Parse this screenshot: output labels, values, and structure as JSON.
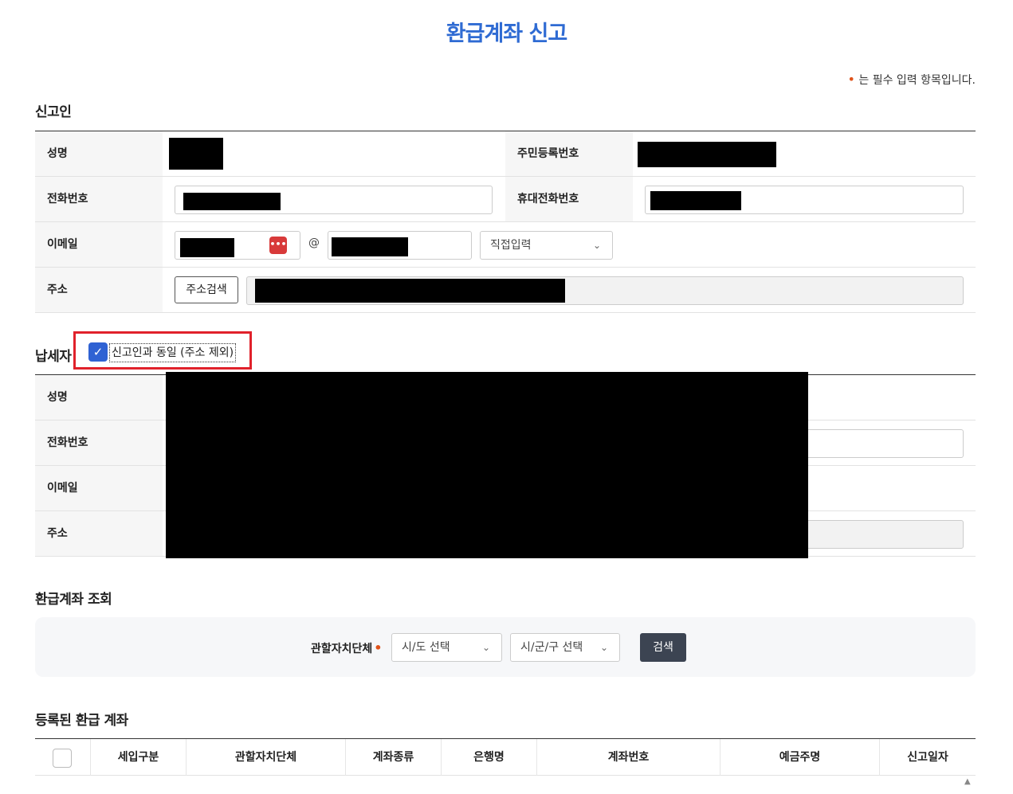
{
  "page": {
    "title": "환급계좌 신고",
    "required_note": "는 필수 입력 항목입니다.",
    "required_mark": "•"
  },
  "reporter": {
    "section_title": "신고인",
    "name_label": "성명",
    "rrn_label": "주민등록번호",
    "phone_label": "전화번호",
    "mobile_label": "휴대전화번호",
    "email_label": "이메일",
    "email_at": "@",
    "email_domain_select": "직접입력",
    "address_label": "주소",
    "address_search_button": "주소검색"
  },
  "taxpayer": {
    "section_title": "납세자",
    "same_as_reporter_label": "신고인과 동일 (주소 제외)",
    "same_as_reporter_checked": true,
    "name_label": "성명",
    "phone_label": "전화번호",
    "email_label": "이메일",
    "address_label": "주소"
  },
  "account_search": {
    "section_title": "환급계좌 조회",
    "jurisdiction_label": "관할자치단체",
    "sido_select": "시/도 선택",
    "sigungu_select": "시/군/구 선택",
    "search_button": "검색"
  },
  "registered_accounts": {
    "section_title": "등록된 환급 계좌",
    "columns": [
      "세입구분",
      "관할자치단체",
      "계좌종류",
      "은행명",
      "계좌번호",
      "예금주명",
      "신고일자"
    ]
  },
  "colors": {
    "title_blue": "#2f6bd3",
    "required_orange": "#e0531b",
    "highlight_red": "#e0212b",
    "checkbox_blue": "#2f62d3",
    "dark_button": "#3c4452"
  }
}
